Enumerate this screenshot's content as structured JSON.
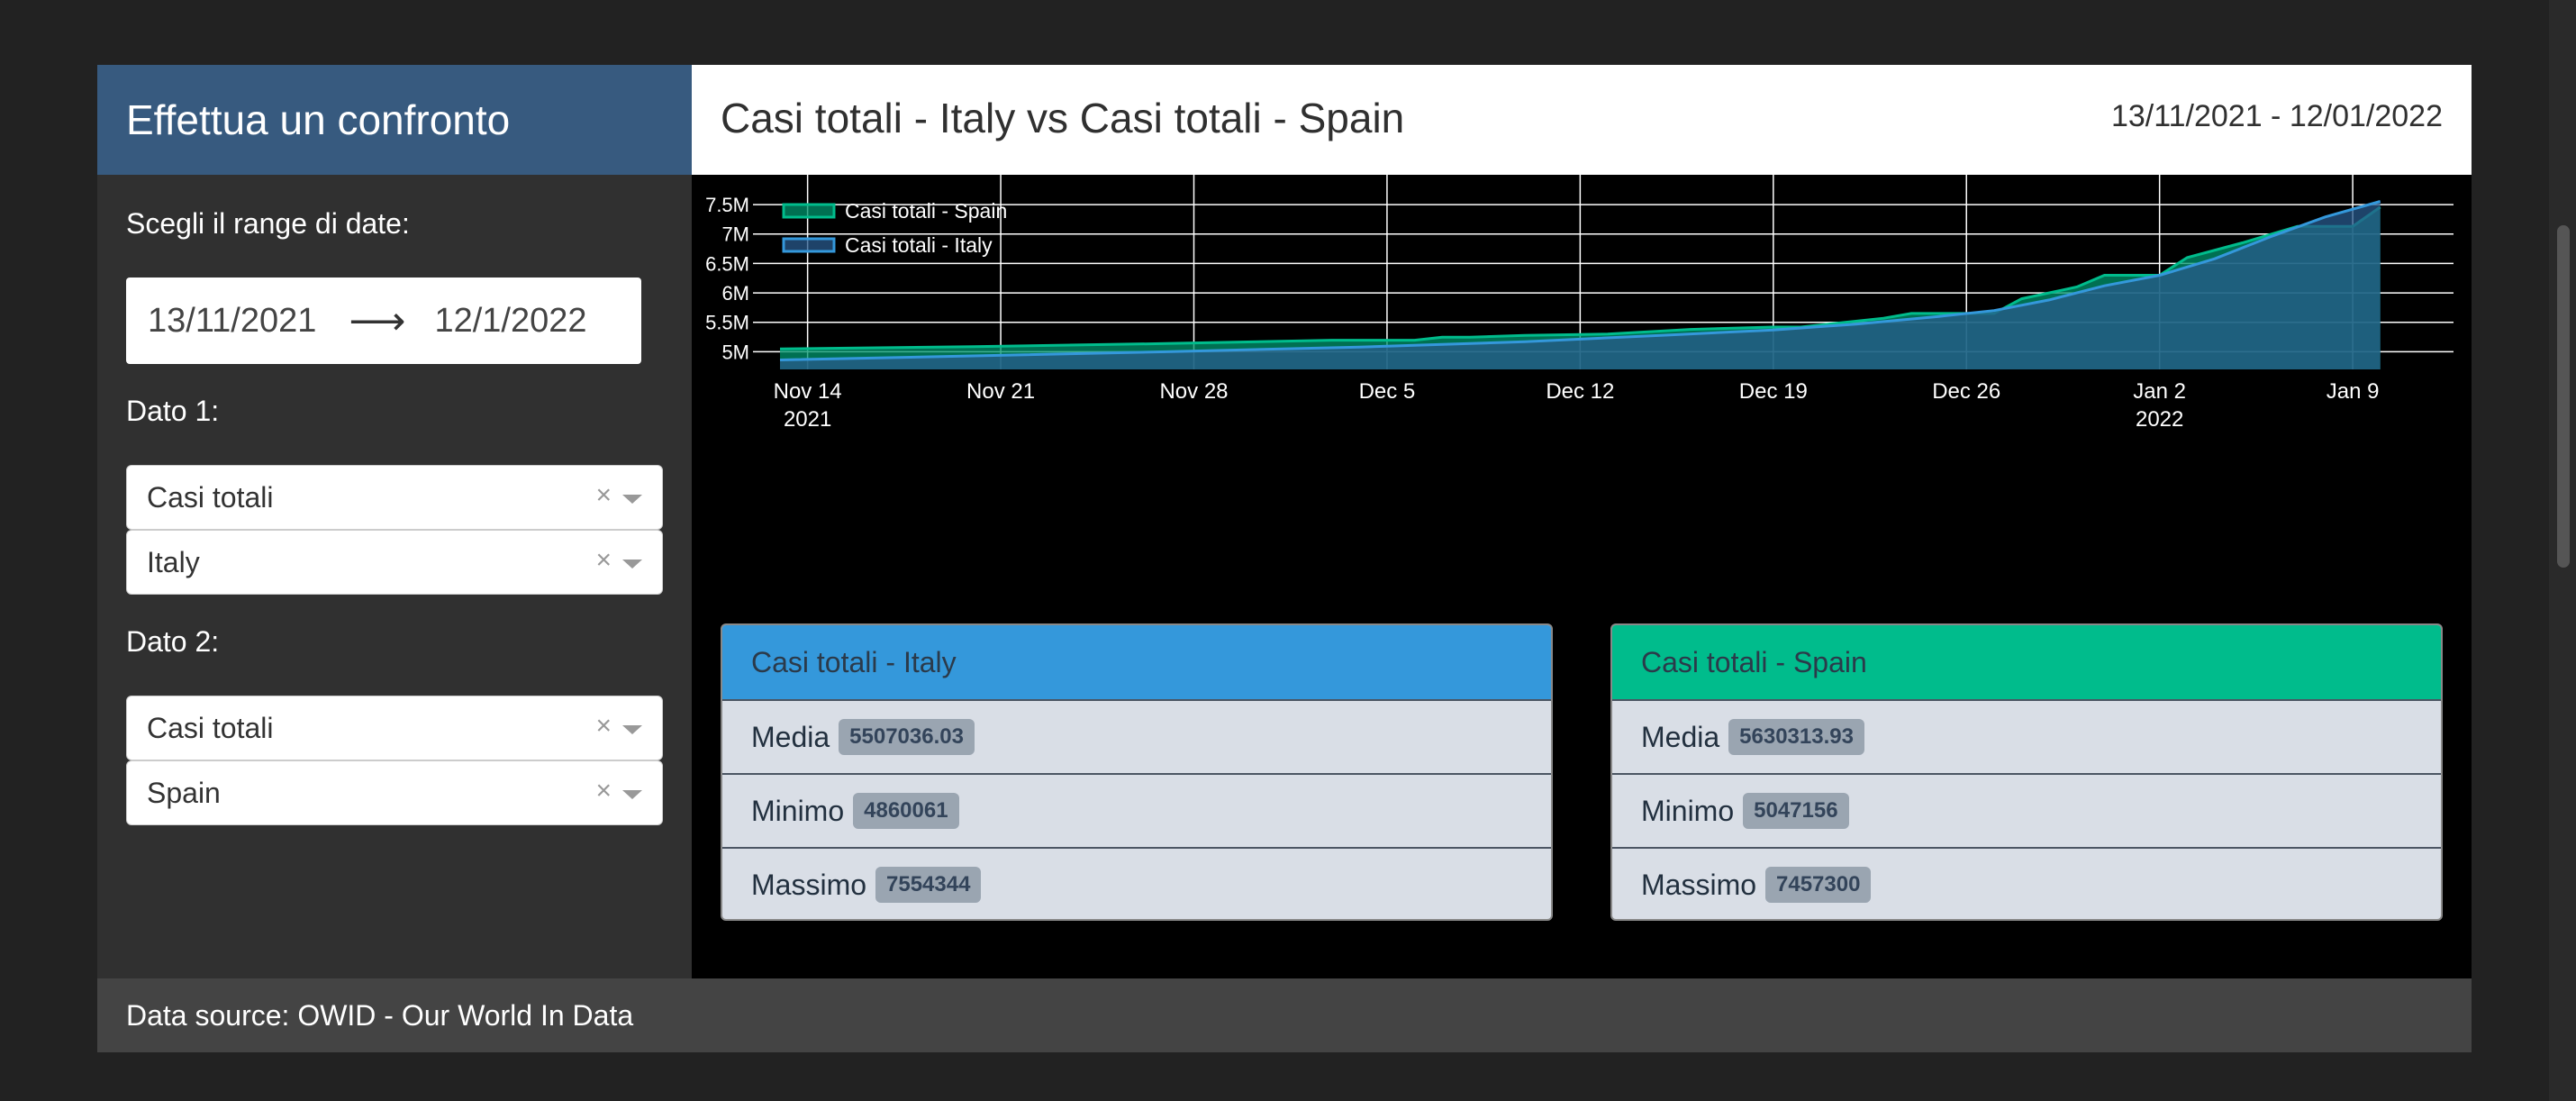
{
  "sidebar": {
    "title": "Effettua un confronto",
    "range_label": "Scegli il range di date:",
    "date_start": "13/11/2021",
    "date_arrow": "⟶",
    "date_end": "12/1/2022",
    "dato1_label": "Dato 1:",
    "dato1_metric": "Casi totali",
    "dato1_country": "Italy",
    "dato2_label": "Dato 2:",
    "dato2_metric": "Casi totali",
    "dato2_country": "Spain",
    "clear_glyph": "×"
  },
  "main": {
    "title": "Casi totali - Italy vs Casi totali - Spain",
    "date_range": "13/11/2021 - 12/01/2022"
  },
  "stats": [
    {
      "title": "Casi totali - Italy",
      "color": "#3498db",
      "media_label": "Media",
      "media_value": "5507036.03",
      "min_label": "Minimo",
      "min_value": "4860061",
      "max_label": "Massimo",
      "max_value": "7554344"
    },
    {
      "title": "Casi totali - Spain",
      "color": "#00bc8c",
      "media_label": "Media",
      "media_value": "5630313.93",
      "min_label": "Minimo",
      "min_value": "5047156",
      "max_label": "Massimo",
      "max_value": "7457300"
    }
  ],
  "footer": {
    "text": "Data source: OWID - Our World In Data"
  },
  "chart_data": {
    "type": "area",
    "x_start": "2021-11-13",
    "x_end": "2022-01-12",
    "x_ticks": [
      {
        "date": "2021-11-14",
        "label": [
          "Nov 14",
          "2021"
        ]
      },
      {
        "date": "2021-11-21",
        "label": [
          "Nov 21"
        ]
      },
      {
        "date": "2021-11-28",
        "label": [
          "Nov 28"
        ]
      },
      {
        "date": "2021-12-05",
        "label": [
          "Dec 5"
        ]
      },
      {
        "date": "2021-12-12",
        "label": [
          "Dec 12"
        ]
      },
      {
        "date": "2021-12-19",
        "label": [
          "Dec 19"
        ]
      },
      {
        "date": "2021-12-26",
        "label": [
          "Dec 26"
        ]
      },
      {
        "date": "2022-01-02",
        "label": [
          "Jan 2",
          "2022"
        ]
      },
      {
        "date": "2022-01-09",
        "label": [
          "Jan 9"
        ]
      }
    ],
    "y_ticks": [
      5000000,
      5500000,
      6000000,
      6500000,
      7000000,
      7500000
    ],
    "y_tick_labels": [
      "5M",
      "5.5M",
      "6M",
      "6.5M",
      "7M",
      "7.5M"
    ],
    "ylim": [
      4700000,
      7700000
    ],
    "grid": true,
    "legend_position": "top-left",
    "series": [
      {
        "name": "Casi totali - Spain",
        "color": "#00bc8c",
        "fill": "rgba(0,150,110,0.75)",
        "points": [
          [
            "2021-11-13",
            5047156
          ],
          [
            "2021-11-20",
            5088000
          ],
          [
            "2021-11-27",
            5140000
          ],
          [
            "2021-12-03",
            5196000
          ],
          [
            "2021-12-06",
            5196000
          ],
          [
            "2021-12-07",
            5246000
          ],
          [
            "2021-12-08",
            5246000
          ],
          [
            "2021-12-10",
            5278000
          ],
          [
            "2021-12-13",
            5300000
          ],
          [
            "2021-12-16",
            5380000
          ],
          [
            "2021-12-19",
            5420000
          ],
          [
            "2021-12-20",
            5420000
          ],
          [
            "2021-12-21",
            5470000
          ],
          [
            "2021-12-23",
            5570000
          ],
          [
            "2021-12-24",
            5650000
          ],
          [
            "2021-12-26",
            5650000
          ],
          [
            "2021-12-27",
            5650000
          ],
          [
            "2021-12-28",
            5900000
          ],
          [
            "2021-12-30",
            6100000
          ],
          [
            "2021-12-31",
            6300000
          ],
          [
            "2022-01-02",
            6300000
          ],
          [
            "2022-01-03",
            6600000
          ],
          [
            "2022-01-05",
            6850000
          ],
          [
            "2022-01-07",
            7130000
          ],
          [
            "2022-01-09",
            7130000
          ],
          [
            "2022-01-10",
            7457300
          ]
        ]
      },
      {
        "name": "Casi totali - Italy",
        "color": "#3498db",
        "fill": "rgba(40,90,140,0.75)",
        "points": [
          [
            "2021-11-13",
            4860061
          ],
          [
            "2021-11-20",
            4930000
          ],
          [
            "2021-11-27",
            5000000
          ],
          [
            "2021-12-04",
            5080000
          ],
          [
            "2021-12-10",
            5170000
          ],
          [
            "2021-12-15",
            5280000
          ],
          [
            "2021-12-19",
            5370000
          ],
          [
            "2021-12-22",
            5470000
          ],
          [
            "2021-12-25",
            5600000
          ],
          [
            "2021-12-27",
            5700000
          ],
          [
            "2021-12-29",
            5880000
          ],
          [
            "2021-12-31",
            6120000
          ],
          [
            "2022-01-02",
            6300000
          ],
          [
            "2022-01-04",
            6580000
          ],
          [
            "2022-01-06",
            6950000
          ],
          [
            "2022-01-08",
            7290000
          ],
          [
            "2022-01-10",
            7554344
          ]
        ]
      }
    ]
  }
}
